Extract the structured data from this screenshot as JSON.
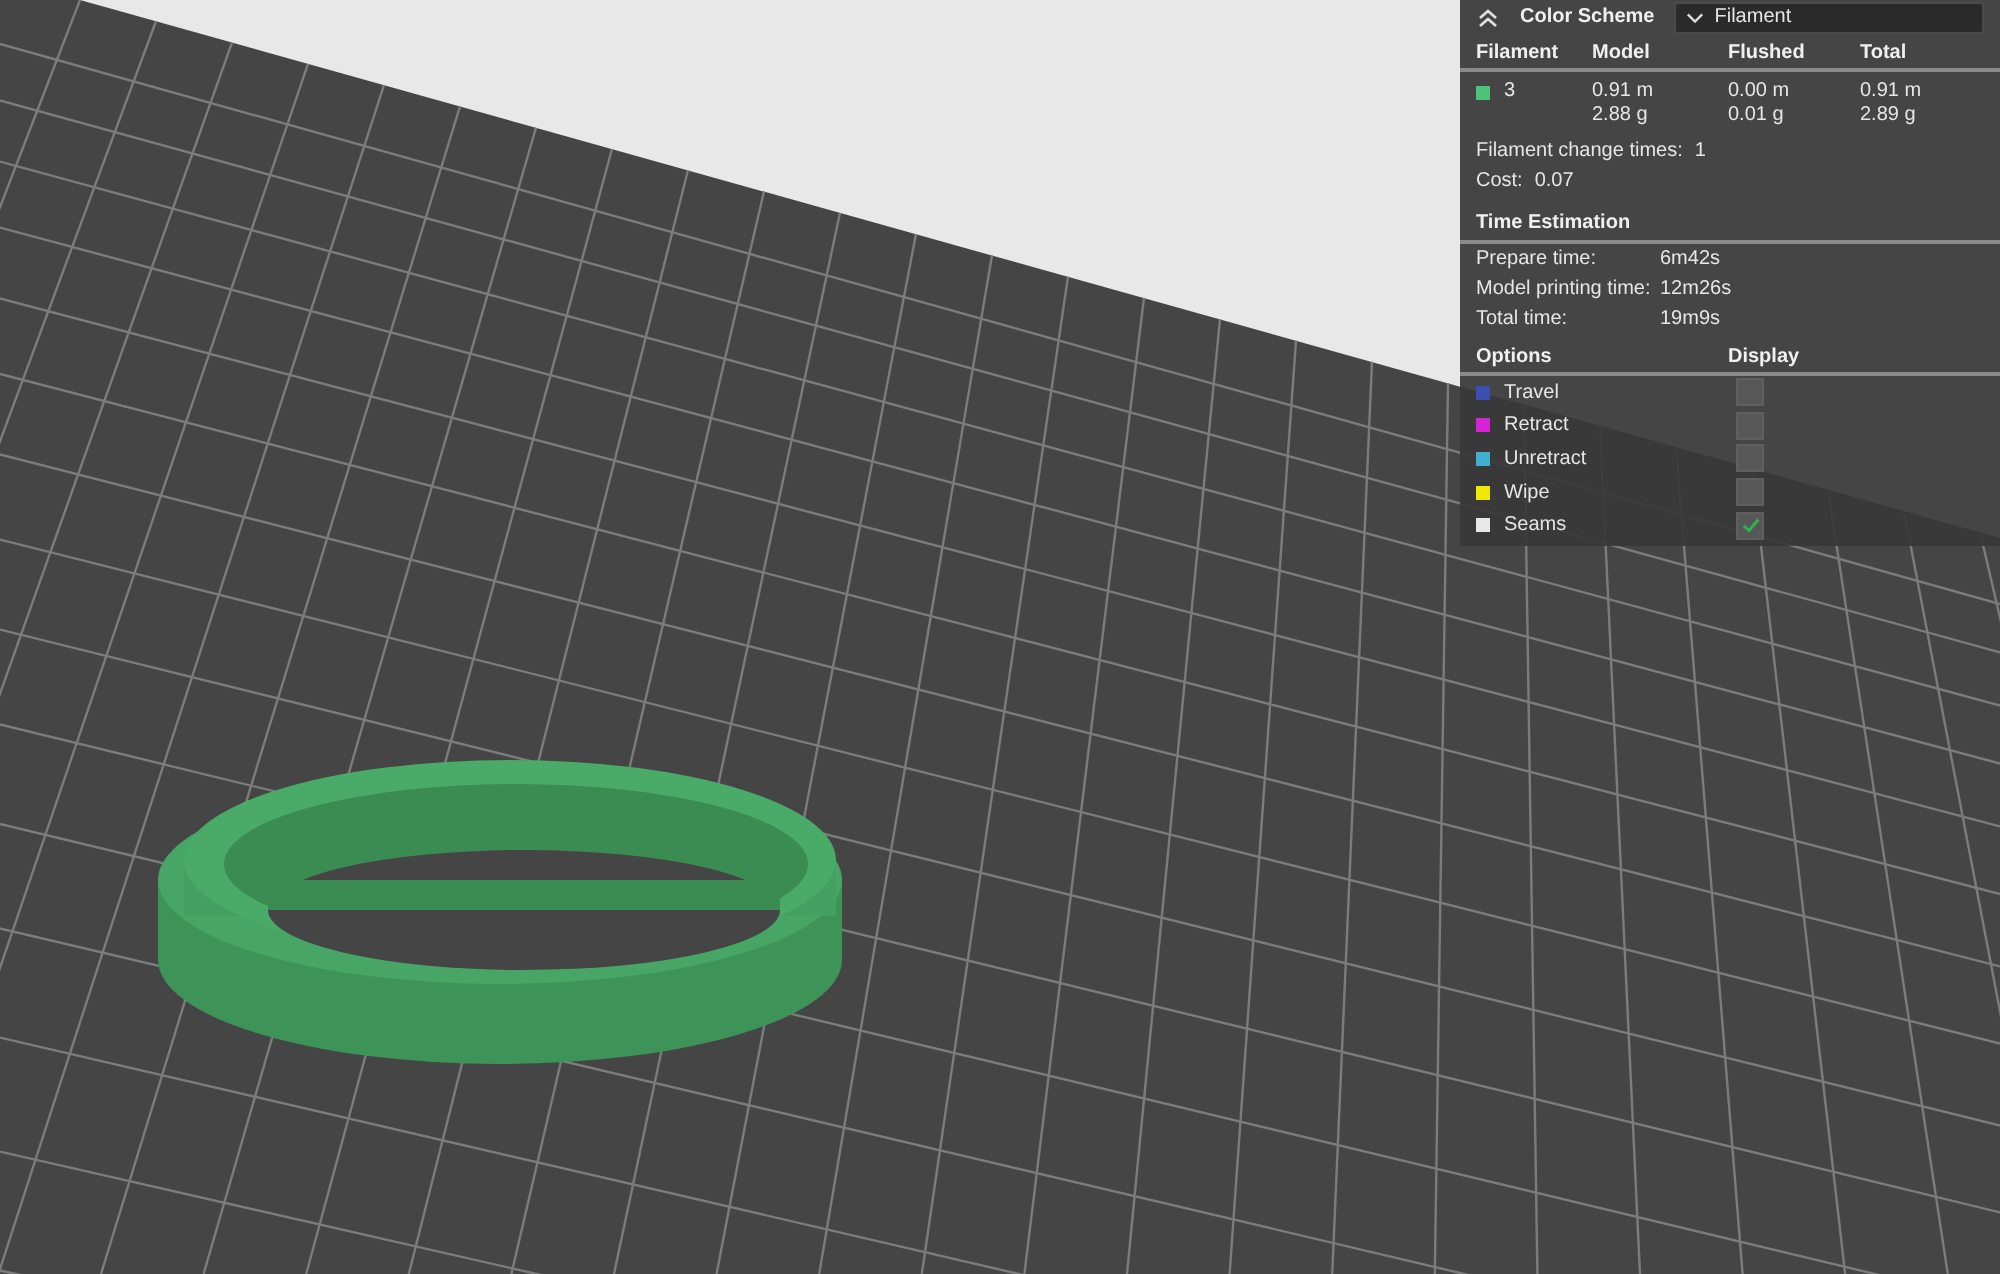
{
  "color_scheme": {
    "label": "Color Scheme",
    "value": "Filament"
  },
  "filament_table": {
    "columns": [
      "Filament",
      "Model",
      "Flushed",
      "Total"
    ],
    "rows": [
      {
        "color": "#4fc27a",
        "filament": "3",
        "model": [
          "0.91 m",
          "2.88 g"
        ],
        "flushed": [
          "0.00 m",
          "0.01 g"
        ],
        "total": [
          "0.91 m",
          "2.89 g"
        ]
      }
    ]
  },
  "filament_change_times": {
    "label": "Filament change times:",
    "value": "1"
  },
  "cost": {
    "label": "Cost:",
    "value": "0.07"
  },
  "time_estimation": {
    "title": "Time Estimation",
    "rows": [
      {
        "label": "Prepare time:",
        "value": "6m42s"
      },
      {
        "label": "Model printing time:",
        "value": "12m26s"
      },
      {
        "label": "Total time:",
        "value": "19m9s"
      }
    ]
  },
  "options": {
    "columns": [
      "Options",
      "Display"
    ],
    "items": [
      {
        "label": "Travel",
        "color": "#3a4fb0",
        "checked": false
      },
      {
        "label": "Retract",
        "color": "#d424d4",
        "checked": false
      },
      {
        "label": "Unretract",
        "color": "#3fb0d0",
        "checked": false
      },
      {
        "label": "Wipe",
        "color": "#f0e800",
        "checked": false
      },
      {
        "label": "Seams",
        "color": "#e8e8e8",
        "checked": true
      }
    ]
  }
}
